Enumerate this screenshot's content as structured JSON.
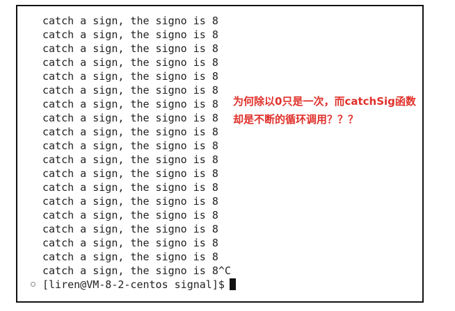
{
  "terminal": {
    "lines": [
      "catch a sign, the signo is 8",
      "catch a sign, the signo is 8",
      "catch a sign, the signo is 8",
      "catch a sign, the signo is 8",
      "catch a sign, the signo is 8",
      "catch a sign, the signo is 8",
      "catch a sign, the signo is 8",
      "catch a sign, the signo is 8",
      "catch a sign, the signo is 8",
      "catch a sign, the signo is 8",
      "catch a sign, the signo is 8",
      "catch a sign, the signo is 8",
      "catch a sign, the signo is 8",
      "catch a sign, the signo is 8",
      "catch a sign, the signo is 8",
      "catch a sign, the signo is 8",
      "catch a sign, the signo is 8",
      "catch a sign, the signo is 8",
      "catch a sign, the signo is 8^C"
    ],
    "prompt": "[liren@VM-8-2-centos signal]$"
  },
  "annotation": {
    "line1": "为何除以0只是一次，而catchSig函数",
    "line2": "却是不断的循环调用？？？",
    "color": "#e0302a"
  }
}
